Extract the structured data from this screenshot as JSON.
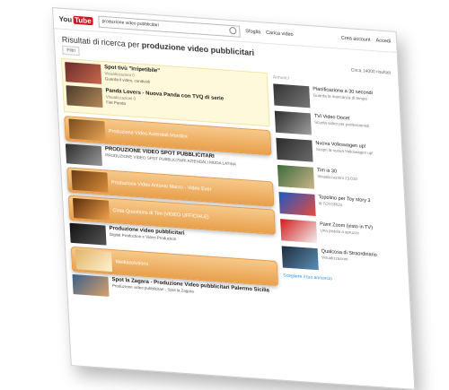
{
  "header": {
    "logo_you": "You",
    "logo_tube": "Tube",
    "search_value": "produzione video pubblicitari",
    "links": [
      "Sfoglia",
      "Carica video"
    ],
    "user": "Crea account",
    "login": "Accedi"
  },
  "page": {
    "heading_prefix": "Risultati di ricerca per",
    "heading_query": "produzione video pubblicitari",
    "filter_label": "Filtri",
    "about_count": "Circa 14000 risultati"
  },
  "ads": [
    {
      "title": "Spot tivù \"Irripetibile\"",
      "meta": "Visualizzazioni 0",
      "desc": "Guarda il video, condividi"
    },
    {
      "title": "Panda Lovers - Nuova Panda con TVQ di serie",
      "meta": "Visualizzazioni 0",
      "desc": "Fiat Panda"
    }
  ],
  "results": [
    {
      "title": "Produzione Video Aziendali Mondox",
      "meta": "",
      "type": "pill"
    },
    {
      "title": "PRODUZIONE VIDEO SPOT PUBBLICITARI",
      "meta": "PRODUZIONE VIDEO SPOT PUBBLICITARI AZIENDALI MODA LATINA",
      "type": "plain"
    },
    {
      "title": "Produzione Video Antonio Marzo - Video Ever",
      "meta": "",
      "type": "pill"
    },
    {
      "title": "Cinta Questions di Tim (VIDEO UFFICIALE)",
      "meta": "",
      "type": "pill"
    },
    {
      "title": "Produzione video pubblicitari",
      "meta": "Digital Production e Video Production",
      "type": "plain"
    },
    {
      "title": "Mediasolutions",
      "meta": "",
      "type": "pill"
    },
    {
      "title": "Spot la Zagara - Produzione Video pubblicitari Palermo Sicilia",
      "meta": "Produzione video pubblicitari - Spot la Zagara",
      "type": "plain"
    }
  ],
  "sidebar": {
    "heading": "Annunci",
    "items": [
      {
        "title": "Pianificazione a 30 secondi",
        "meta": "Guarda la mancanza di tempo"
      },
      {
        "title": "TVi Video Docet",
        "meta": "Scuola video per professionisti"
      },
      {
        "title": "Nuova Volkswagen up!",
        "meta": "Scopri la nuova Volkswagen up!"
      },
      {
        "title": "Tim is 30",
        "meta": "Visualizzazioni 23.010"
      },
      {
        "title": "Topolino per Toy story 3",
        "meta": "di TOYSRUS"
      },
      {
        "title": "Paint Zoom (visto in TV)",
        "meta": "Una pistola a spruzzo"
      },
      {
        "title": "Qualcosa di Straordinario",
        "meta": "Visualizzazioni"
      }
    ],
    "footer": "Scegliere il tuo annuncio"
  }
}
